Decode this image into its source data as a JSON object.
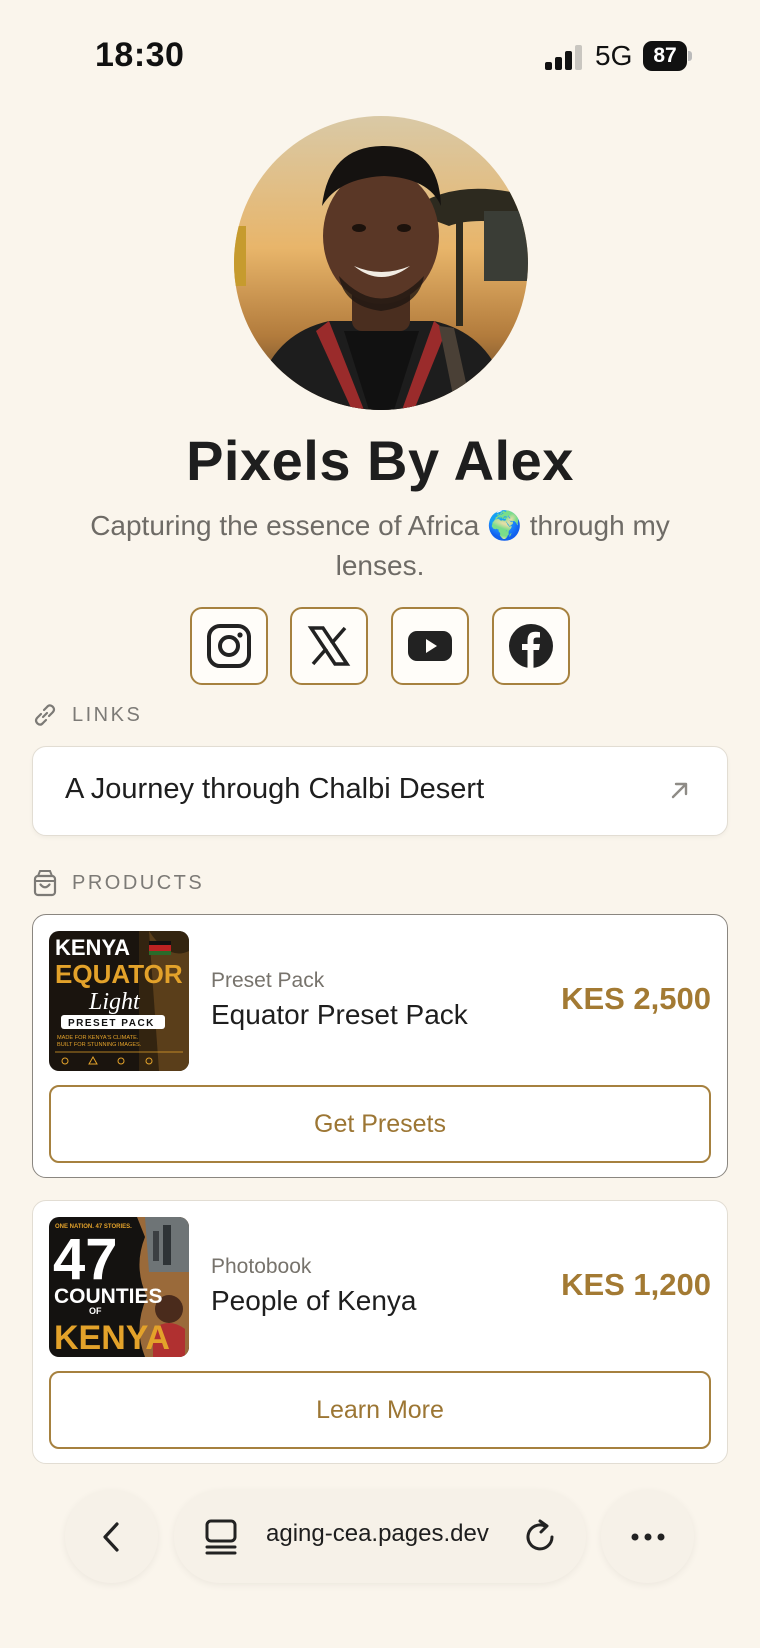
{
  "status": {
    "time": "18:30",
    "network": "5G",
    "battery": "87"
  },
  "profile": {
    "name": "Pixels By Alex",
    "bio": "Capturing the essence of Africa 🌍 through my lenses."
  },
  "socials": [
    {
      "name": "Instagram",
      "icon": "instagram-icon"
    },
    {
      "name": "X",
      "icon": "x-icon"
    },
    {
      "name": "YouTube",
      "icon": "youtube-icon"
    },
    {
      "name": "Facebook",
      "icon": "facebook-icon"
    }
  ],
  "links_section": {
    "label": "LINKS",
    "items": [
      {
        "title": "A Journey through Chalbi Desert",
        "icon": "external-arrow-icon"
      }
    ]
  },
  "products_section": {
    "label": "PRODUCTS",
    "items": [
      {
        "category": "Preset Pack",
        "name": "Equator Preset Pack",
        "price": "KES 2,500",
        "button": "Get Presets",
        "thumb": {
          "line1": "KENYA",
          "line2": "EQUATOR",
          "line3": "Light",
          "line4": "PRESET PACK",
          "line5": "MADE FOR KENYA'S CLIMATE.",
          "line6": "BUILT FOR STUNNING IMAGES."
        }
      },
      {
        "category": "Photobook",
        "name": "People of Kenya",
        "price": "KES 1,200",
        "button": "Learn More",
        "thumb": {
          "line1": "ONE NATION. 47 STORIES.",
          "line2": "47",
          "line3": "COUNTIES",
          "line4": "OF",
          "line5": "KENYA"
        }
      }
    ]
  },
  "browser": {
    "url": "aging-cea.pages.dev"
  },
  "colors": {
    "accent": "#a6813f",
    "price": "#a37a33",
    "background": "#faf5ec"
  }
}
